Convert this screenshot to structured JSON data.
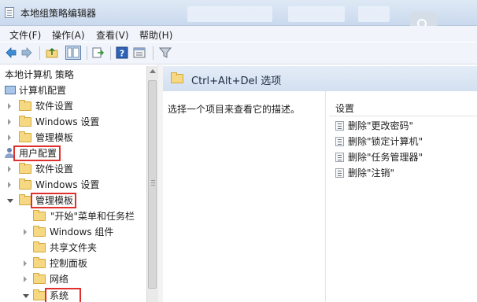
{
  "window": {
    "title": "本地组策略编辑器"
  },
  "menu": [
    "文件(F)",
    "操作(A)",
    "查看(V)",
    "帮助(H)"
  ],
  "tree": {
    "root_label": "本地计算机 策略",
    "computer_config": "计算机配置",
    "computer_children": [
      "软件设置",
      "Windows 设置",
      "管理模板"
    ],
    "user_config": "用户配置",
    "user_children": [
      "软件设置",
      "Windows 设置",
      "管理模板"
    ],
    "admin_children": [
      "\"开始\"菜单和任务栏",
      "Windows 组件",
      "共享文件夹",
      "控制面板",
      "网络",
      "系统"
    ]
  },
  "detail": {
    "header": "Ctrl+Alt+Del 选项",
    "description": "选择一个项目来查看它的描述。",
    "column_header": "设置",
    "items": [
      "删除\"更改密码\"",
      "删除\"锁定计算机\"",
      "删除\"任务管理器\"",
      "删除\"注销\""
    ]
  },
  "highlight_color": "#e0302d"
}
